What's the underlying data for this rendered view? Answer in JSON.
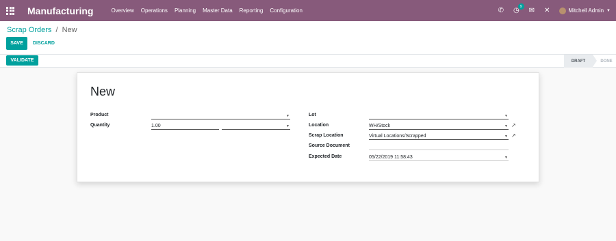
{
  "navbar": {
    "brand": "Manufacturing",
    "menu": [
      "Overview",
      "Operations",
      "Planning",
      "Master Data",
      "Reporting",
      "Configuration"
    ],
    "activity_badge": "9",
    "user_name": "Mitchell Admin",
    "icons": [
      "apps-grid-icon",
      "phone-icon",
      "activity-clock-icon",
      "chat-icon",
      "close-icon",
      "caret-down-icon"
    ]
  },
  "breadcrumb": {
    "parent": "Scrap Orders",
    "separator": "/",
    "current": "New"
  },
  "buttons": {
    "save": "SAVE",
    "discard": "DISCARD",
    "validate": "VALIDATE"
  },
  "status": {
    "draft": "DRAFT",
    "done": "DONE",
    "active": "DRAFT"
  },
  "form": {
    "title": "New",
    "product_label": "Product",
    "product_value": "",
    "quantity_label": "Quantity",
    "quantity_value": "1.00",
    "uom_value": "",
    "lot_label": "Lot",
    "lot_value": "",
    "location_label": "Location",
    "location_value": "WH/Stock",
    "scrap_location_label": "Scrap Location",
    "scrap_location_value": "Virtual Locations/Scrapped",
    "source_document_label": "Source Document",
    "source_document_value": "",
    "expected_date_label": "Expected Date",
    "expected_date_value": "05/22/2019 11:58:43"
  },
  "colors": {
    "brand": "#875a7b",
    "accent": "#00a09d"
  }
}
